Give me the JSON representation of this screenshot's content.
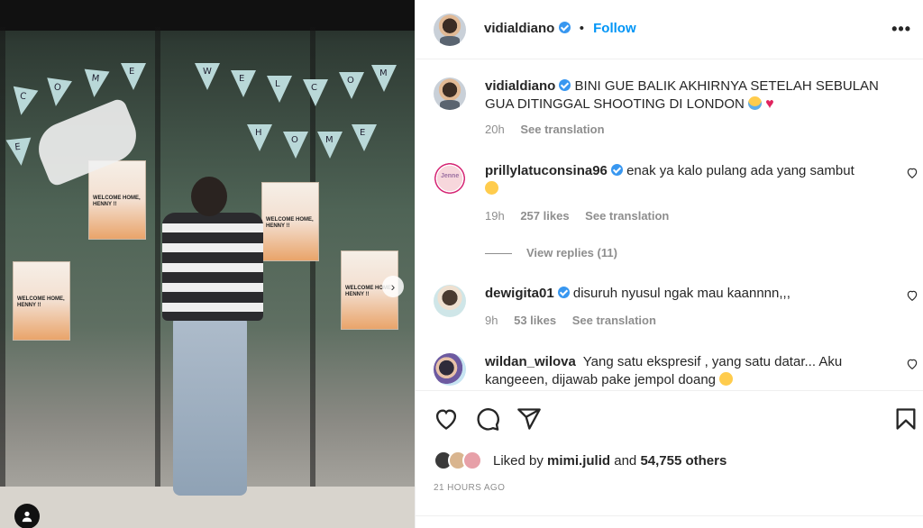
{
  "post": {
    "username": "vidialdiano",
    "follow_label": "Follow",
    "more_label": "•••",
    "caption": {
      "username": "vidialdiano",
      "text": "BINI GUE BALIK AKHIRNYA SETELAH SEBULAN GUA DITINGGAL SHOOTING DI LONDON",
      "time": "20h",
      "see_translation": "See translation"
    },
    "comments": [
      {
        "username": "prillylatuconsina96",
        "text": "enak ya kalo pulang ada yang sambut",
        "time": "19h",
        "likes": "257 likes",
        "see_translation": "See translation",
        "view_replies": "View replies (11)",
        "avatar_text": "Jenne"
      },
      {
        "username": "dewigita01",
        "text": "disuruh nyusul ngak mau kaannnn,,,",
        "time": "9h",
        "likes": "53 likes",
        "see_translation": "See translation"
      },
      {
        "username": "wildan_wilova",
        "text": "Yang satu ekspresif , yang satu datar... Aku kangeeen, dijawab pake jempol doang"
      }
    ],
    "liked_by": {
      "prefix": "Liked by",
      "user": "mimi.julid",
      "and": "and",
      "others": "54,755 others"
    },
    "timestamp": "21 HOURS AGO"
  },
  "media": {
    "banner_letters": [
      "C",
      "O",
      "M",
      "E",
      "W",
      "E",
      "L",
      "C",
      "O",
      "M",
      "E",
      "H",
      "O",
      "M",
      "E"
    ],
    "poster_text": "WELCOME HOME, HENNY !!",
    "next_icon": "chevron-right-icon",
    "tag_icon": "user-tag-icon"
  },
  "icons": {
    "like": "heart-icon",
    "comment": "comment-icon",
    "share": "share-icon",
    "save": "bookmark-icon",
    "verified": "verified-badge-icon"
  },
  "colors": {
    "accent": "#0095f6",
    "verified": "#3897f0",
    "text": "#262626",
    "muted": "#8e8e8e",
    "heart": "#e0245e"
  }
}
